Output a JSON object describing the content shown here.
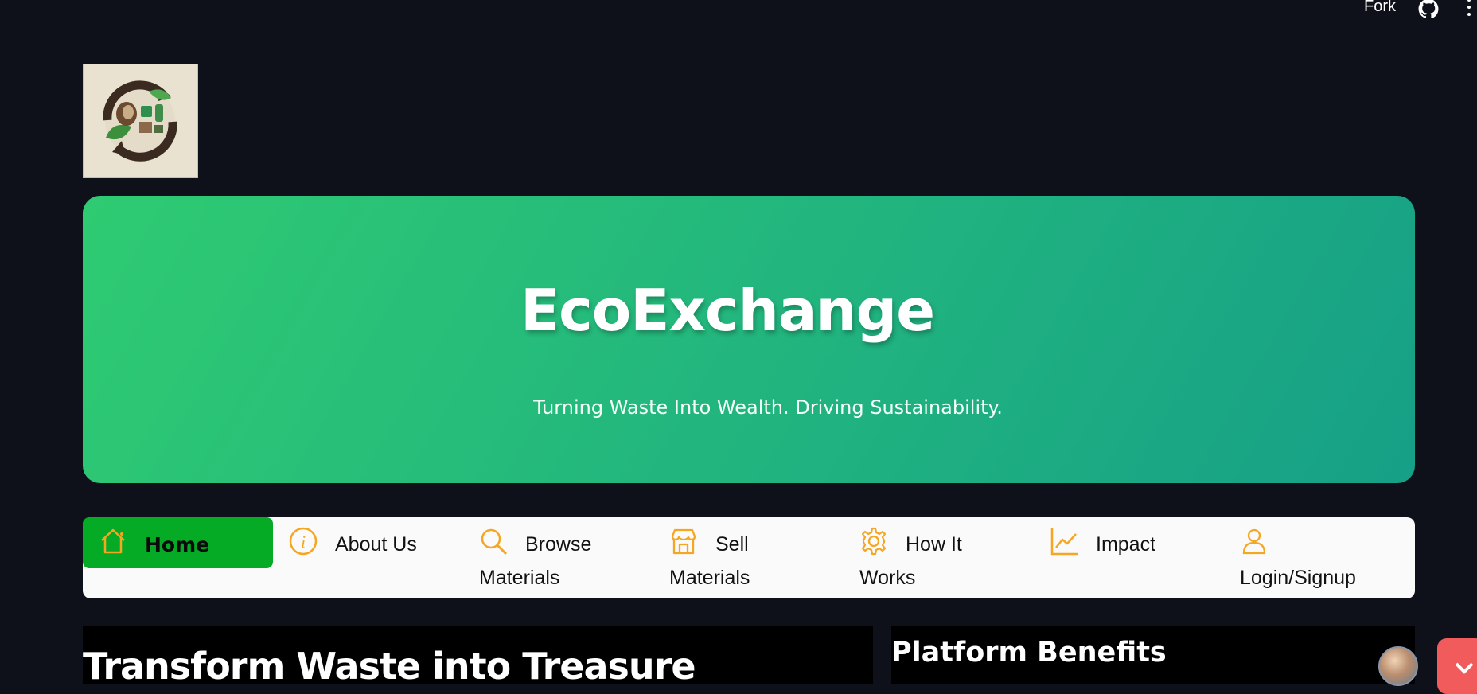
{
  "topbar": {
    "fork_label": "Fork",
    "github_icon": "github-icon",
    "menu_icon": "kebab-menu-icon"
  },
  "logo": {
    "alt": "EcoExchange logo",
    "icon": "recycle-logo-icon"
  },
  "hero": {
    "title": "EcoExchange",
    "subtitle": "Turning Waste Into Wealth. Driving Sustainability."
  },
  "nav": {
    "active_color": "#05aa25",
    "icon_color": "#f5a623",
    "items": [
      {
        "line1": "Home",
        "line2": "",
        "icon": "home-icon",
        "active": true
      },
      {
        "line1": "About Us",
        "line2": "",
        "icon": "info-icon"
      },
      {
        "line1": "Browse",
        "line2": "Materials",
        "icon": "search-icon"
      },
      {
        "line1": "Sell",
        "line2": "Materials",
        "icon": "store-icon"
      },
      {
        "line1": "How It",
        "line2": "Works",
        "icon": "gear-icon"
      },
      {
        "line1": "Impact",
        "line2": "",
        "icon": "chart-line-icon"
      },
      {
        "line1": "",
        "line2": "Login/Signup",
        "icon": "user-icon"
      }
    ]
  },
  "main": {
    "heading": "Transform Waste into Treasure"
  },
  "side": {
    "heading": "Platform Benefits"
  },
  "colors": {
    "background": "#0e111a",
    "hero_start": "#2fcb72",
    "hero_end": "#16a087",
    "chat": "#f25b5b"
  }
}
